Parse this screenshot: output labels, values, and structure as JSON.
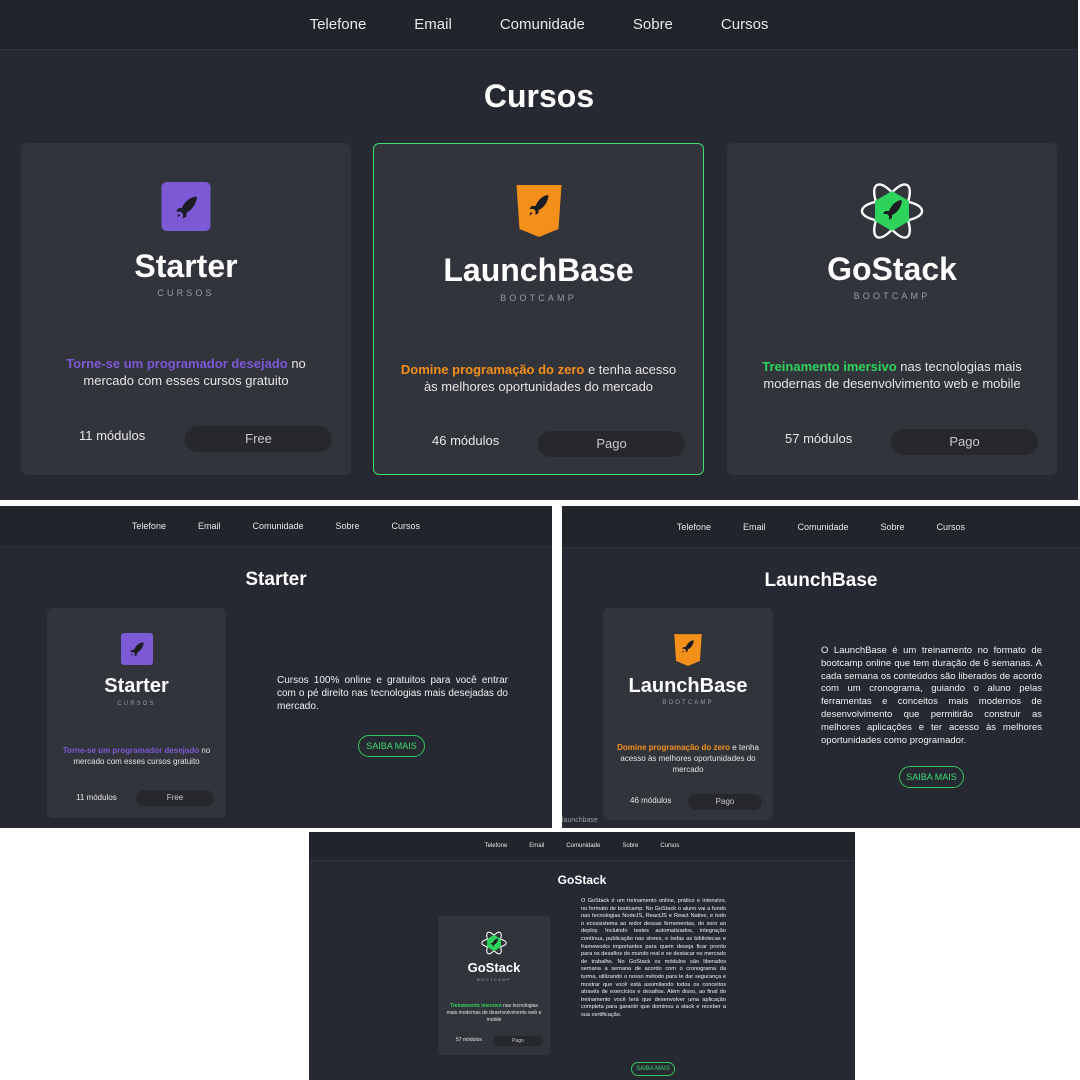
{
  "nav": [
    "Telefone",
    "Email",
    "Comunidade",
    "Sobre",
    "Cursos"
  ],
  "courses_page": {
    "title": "Cursos",
    "cards": [
      {
        "brand": "Starter",
        "sub": "CURSOS",
        "highlight": "Torne-se um programador desejado",
        "rest": " no mercado com esses cursos gratuito",
        "modules": "11 módulos",
        "price": "Free",
        "logo": "starter-rocket-icon",
        "color": "#7c5ad6"
      },
      {
        "brand": "LaunchBase",
        "sub": "BOOTCAMP",
        "highlight": "Domine programação do zero",
        "rest": " e tenha acesso às melhores oportunidades do mercado",
        "modules": "46 módulos",
        "price": "Pago",
        "logo": "launchbase-rocket-icon",
        "color": "#f4901a"
      },
      {
        "brand": "GoStack",
        "sub": "BOOTCAMP",
        "highlight": "Treinamento imersivo",
        "rest": " nas tecnologias mais modernas de desenvolvimento web e mobile",
        "modules": "57 módulos",
        "price": "Pago",
        "logo": "gostack-rocket-icon",
        "color": "#2ed35c"
      }
    ]
  },
  "starter_page": {
    "title": "Starter",
    "text": "Cursos 100% online e gratuitos para você entrar com o pé direito nas tecnologias mais desejadas do mercado.",
    "button": "SAIBA MAIS"
  },
  "launchbase_page": {
    "title": "LaunchBase",
    "text": "O LaunchBase é um treinamento no formato de bootcamp online que tem duração de 6 semanas. A cada semana os conteúdos são liberados de acordo com um cronograma, guiando o aluno pelas ferramentas e conceitos mais modernos de desenvolvimento que permitirão construir as melhores aplicações e ter acesso às melhores oportunidades como programador.",
    "button": "SAIBA MAIS",
    "footer_label": "launchbase"
  },
  "gostack_page": {
    "title": "GoStack",
    "text": "O GoStack é um treinamento online, prático e intensivo, no formato de bootcamp. No GoStack o aluno vai a fundo nas tecnologias NodeJS, ReactJS e React Native, e todo o ecossistema ao redor dessas ferramentas, do zero ao deploy. Incluindo testes automatizados, integração contínua, publicação nas stores, e todas as bibliotecas e frameworks importantes para quem deseja ficar pronto para os desafios do mundo real e se destacar no mercado de trabalho. No GoStack os módulos são liberados semana a semana de acordo com o cronograma da turma, utilizando o nosso método para te dar segurança e mostrar que você está assimilando todos os conceitos através de exercícios e desafios. Além disso, ao final do treinamento você terá que desenvolver uma aplicação completa para garantir que dominou a stack e receber a sua certificação.",
    "button": "SAIBA MAIS"
  }
}
